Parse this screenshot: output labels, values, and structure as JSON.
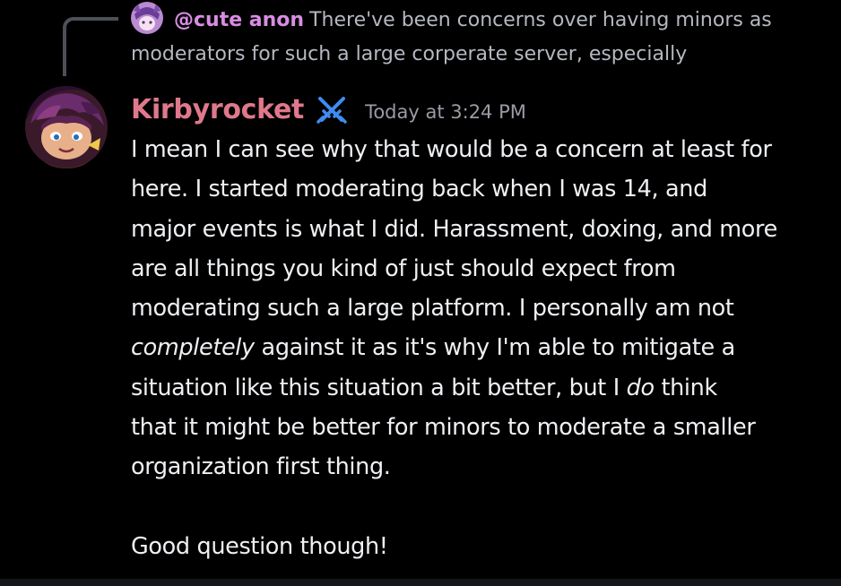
{
  "colors": {
    "background": "#000000",
    "reply_spine": "#4e5058",
    "reply_username": "#d88de3",
    "reply_text": "#b5b8c0",
    "username": "#e0788c",
    "moderator_icon": "#3f8cf0",
    "timestamp": "#9a9ca4",
    "message_text": "#eef0f3"
  },
  "reply": {
    "avatar_icon": "reply-avatar",
    "username": "@cute anon",
    "text_line1": "There've been concerns over having minors as",
    "text_line2": "moderators for such a large corperate server, especially"
  },
  "message": {
    "avatar_icon": "user-avatar",
    "username": "Kirbyrocket",
    "role_icon": "crossed-swords-moderator-icon",
    "timestamp": "Today at 3:24 PM",
    "lines": {
      "l1": "I mean I can see why that would be a concern at least for",
      "l2": "here.  I started moderating back when I was 14, and",
      "l3": "major events is what I did. Harassment, doxing, and more",
      "l4": "are all things you kind of just should expect from",
      "l5": "moderating such a large platform. I personally am not",
      "l6_italic": "completely",
      "l6_rest": " against it as it's why I'm able to mitigate a",
      "l7_start": "situation like this situation a bit better, but I ",
      "l7_italic": "do",
      "l7_rest": " think",
      "l8": "that it might be better for minors to moderate a smaller",
      "l9": "organization first thing.",
      "l10": "Good question though!"
    }
  }
}
